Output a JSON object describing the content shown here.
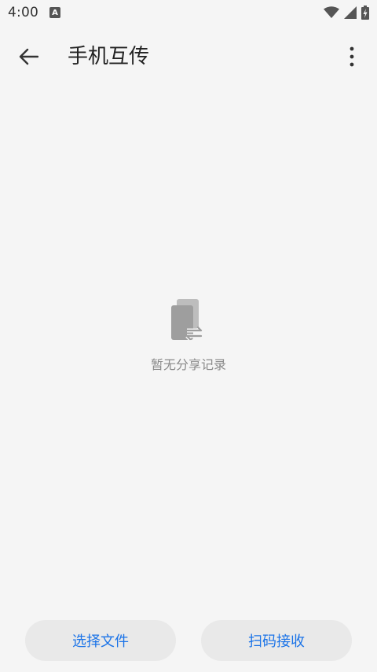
{
  "status": {
    "time": "4:00",
    "badge": "A",
    "icons": [
      "wifi-icon",
      "signal-icon",
      "battery-charging-icon"
    ]
  },
  "header": {
    "title": "手机互传",
    "back_icon": "arrow-left-icon",
    "more_icon": "more-vert-icon"
  },
  "empty": {
    "icon": "phone-transfer-icon",
    "text": "暂无分享记录"
  },
  "actions": {
    "select_files": "选择文件",
    "scan_receive": "扫码接收"
  },
  "colors": {
    "accent": "#1a73e8",
    "background": "#f5f5f5",
    "button_bg": "#e9e9e9",
    "icon_gray": "#9e9e9e"
  }
}
